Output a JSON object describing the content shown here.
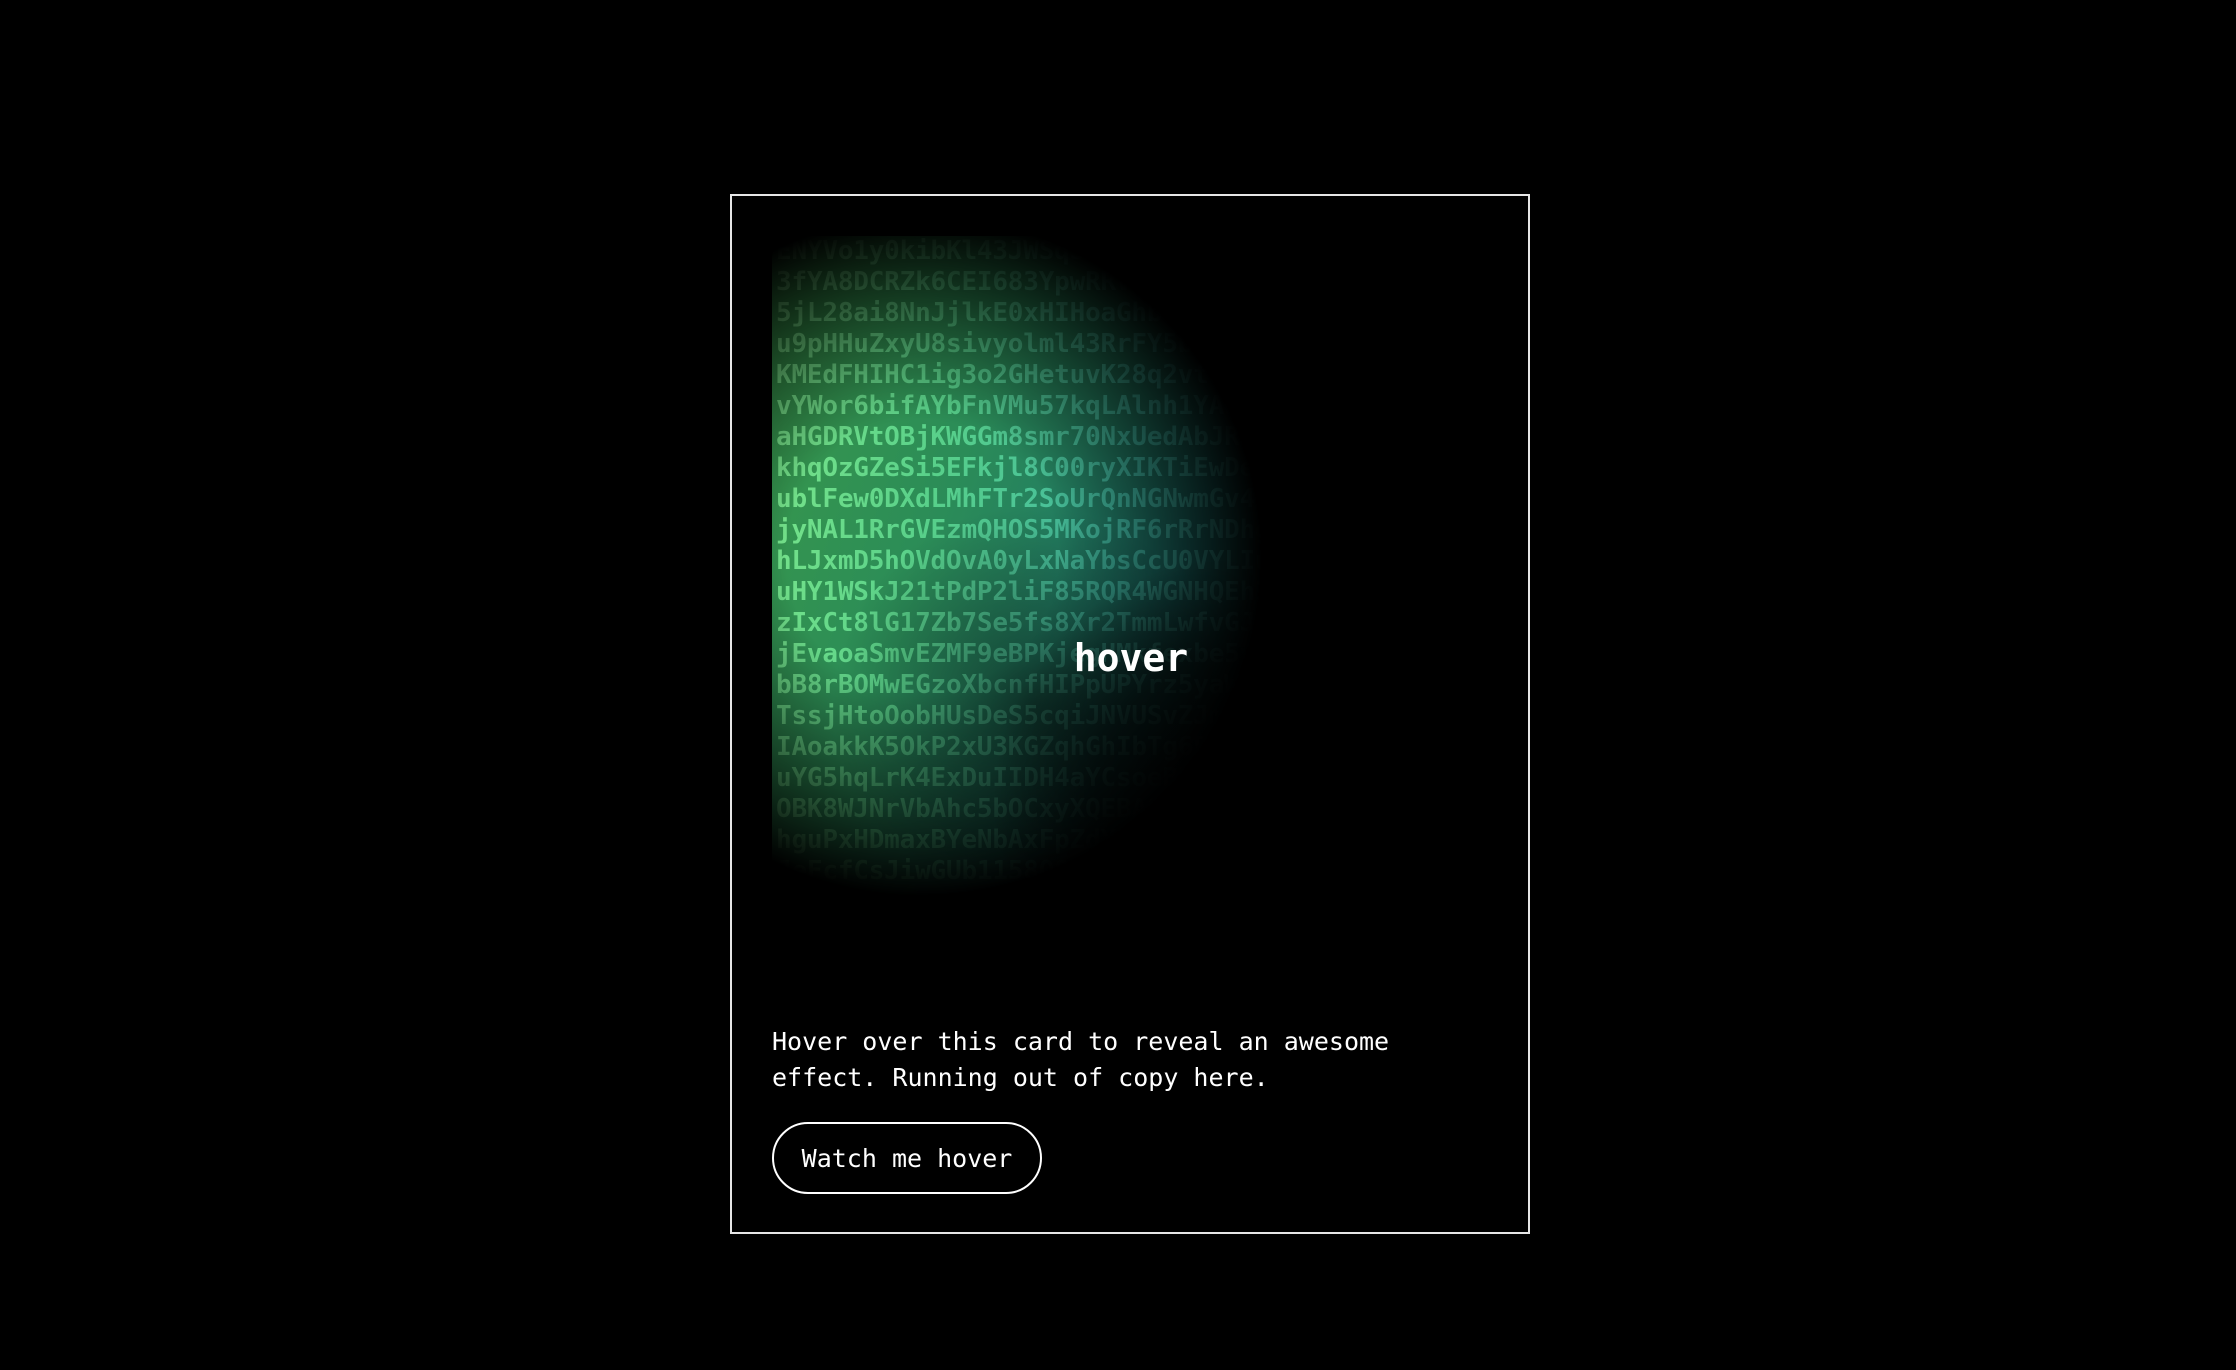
{
  "card": {
    "visual_label": "hover",
    "code_lines": [
      "ENYVo1y0kibKl43JWSqS5uBi2HwiYc",
      "3fYA8DCRZk6CEI683YpwRRVTaAzFttw",
      "5jL28ai8NnJjlkE0xHIHoaGhbGcriP67",
      "u9pHHuZxyU8sivyolml43RrFY5bbcmKb7p",
      "KMEdFHIHC1ig3o2GHetuvK28q2vtu0ZOgm",
      "vYWor6bifAYbFnVMu57kqLAlnh1YAWizFiq",
      "aHGDRVtOBjKWGGm8smr70NxUedAbJR3FY8xm",
      "khqOzGZeSi5EFkjl8C00ryXIKTiEwDe1qIl",
      "ublFew0DXdLMhFTr2SoUrQnNGNwmGv4sv5yj",
      "jyNAL1RrGVEzmQHOS5MKojRF6rRrNDhgGgZb",
      "hLJxmD5hOVdOvA0yLxNaYbsCcU0VYLIu0Lp1",
      "uHY1WSkJ21tPdP2liF85RQR4WGNHQEhI2VbC",
      "zIxCt8lG17Zb7Se5fs8Xr2TmmLwfvGJ0Czm",
      "jEvaoaSmvEZMF9eBPKjegHMkfexbe5vXdU",
      "bB8rBOMwEGzoXbcnfHIPpUPYrz5yaWs8k",
      "TssjHtoOobHUsDeS5cqiJNVUSvZJmvUZ",
      "IAoakkK5OkP2xU3KGZqhGhIbTg6PsQPb",
      "uYG5hqLrK4ExDuIIDH4aYCsoeBBkWf",
      "OBK8WJNrVbAhc5bOCxyXQEBAS8IK",
      "hguPxHDmaxBYeNbAxFpZdYPXDi",
      "JeFcfCsJiwGUb1158Q8Hn"
    ],
    "description": "Hover over this card to reveal an awesome effect. Running out of copy here.",
    "button_label": "Watch me hover"
  },
  "colors": {
    "background": "#000000",
    "text": "#ffffff",
    "accent_green": "#4fbf6a",
    "accent_teal": "#1f7f8a"
  }
}
